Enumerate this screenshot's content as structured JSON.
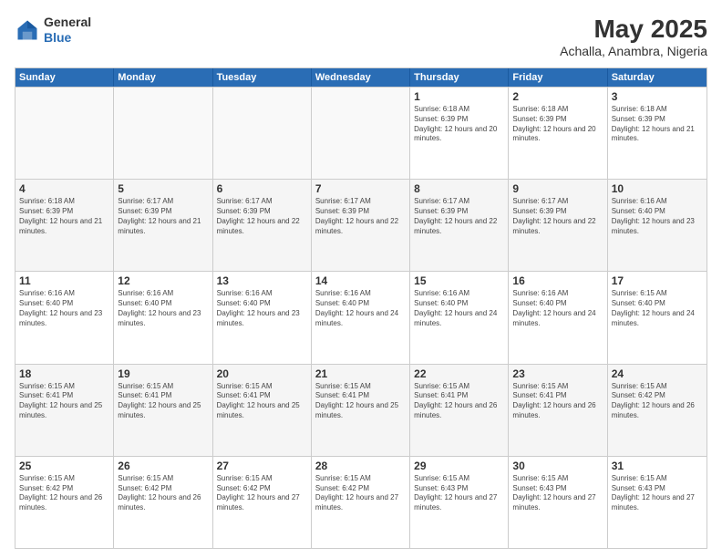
{
  "header": {
    "logo_line1": "General",
    "logo_line2": "Blue",
    "title": "May 2025",
    "subtitle": "Achalla, Anambra, Nigeria"
  },
  "days_of_week": [
    "Sunday",
    "Monday",
    "Tuesday",
    "Wednesday",
    "Thursday",
    "Friday",
    "Saturday"
  ],
  "weeks": [
    [
      {
        "day": "",
        "empty": true
      },
      {
        "day": "",
        "empty": true
      },
      {
        "day": "",
        "empty": true
      },
      {
        "day": "",
        "empty": true
      },
      {
        "day": "1",
        "sunrise": "6:18 AM",
        "sunset": "6:39 PM",
        "daylight": "12 hours and 20 minutes."
      },
      {
        "day": "2",
        "sunrise": "6:18 AM",
        "sunset": "6:39 PM",
        "daylight": "12 hours and 20 minutes."
      },
      {
        "day": "3",
        "sunrise": "6:18 AM",
        "sunset": "6:39 PM",
        "daylight": "12 hours and 21 minutes."
      }
    ],
    [
      {
        "day": "4",
        "sunrise": "6:18 AM",
        "sunset": "6:39 PM",
        "daylight": "12 hours and 21 minutes."
      },
      {
        "day": "5",
        "sunrise": "6:17 AM",
        "sunset": "6:39 PM",
        "daylight": "12 hours and 21 minutes."
      },
      {
        "day": "6",
        "sunrise": "6:17 AM",
        "sunset": "6:39 PM",
        "daylight": "12 hours and 22 minutes."
      },
      {
        "day": "7",
        "sunrise": "6:17 AM",
        "sunset": "6:39 PM",
        "daylight": "12 hours and 22 minutes."
      },
      {
        "day": "8",
        "sunrise": "6:17 AM",
        "sunset": "6:39 PM",
        "daylight": "12 hours and 22 minutes."
      },
      {
        "day": "9",
        "sunrise": "6:17 AM",
        "sunset": "6:39 PM",
        "daylight": "12 hours and 22 minutes."
      },
      {
        "day": "10",
        "sunrise": "6:16 AM",
        "sunset": "6:40 PM",
        "daylight": "12 hours and 23 minutes."
      }
    ],
    [
      {
        "day": "11",
        "sunrise": "6:16 AM",
        "sunset": "6:40 PM",
        "daylight": "12 hours and 23 minutes."
      },
      {
        "day": "12",
        "sunrise": "6:16 AM",
        "sunset": "6:40 PM",
        "daylight": "12 hours and 23 minutes."
      },
      {
        "day": "13",
        "sunrise": "6:16 AM",
        "sunset": "6:40 PM",
        "daylight": "12 hours and 23 minutes."
      },
      {
        "day": "14",
        "sunrise": "6:16 AM",
        "sunset": "6:40 PM",
        "daylight": "12 hours and 24 minutes."
      },
      {
        "day": "15",
        "sunrise": "6:16 AM",
        "sunset": "6:40 PM",
        "daylight": "12 hours and 24 minutes."
      },
      {
        "day": "16",
        "sunrise": "6:16 AM",
        "sunset": "6:40 PM",
        "daylight": "12 hours and 24 minutes."
      },
      {
        "day": "17",
        "sunrise": "6:15 AM",
        "sunset": "6:40 PM",
        "daylight": "12 hours and 24 minutes."
      }
    ],
    [
      {
        "day": "18",
        "sunrise": "6:15 AM",
        "sunset": "6:41 PM",
        "daylight": "12 hours and 25 minutes."
      },
      {
        "day": "19",
        "sunrise": "6:15 AM",
        "sunset": "6:41 PM",
        "daylight": "12 hours and 25 minutes."
      },
      {
        "day": "20",
        "sunrise": "6:15 AM",
        "sunset": "6:41 PM",
        "daylight": "12 hours and 25 minutes."
      },
      {
        "day": "21",
        "sunrise": "6:15 AM",
        "sunset": "6:41 PM",
        "daylight": "12 hours and 25 minutes."
      },
      {
        "day": "22",
        "sunrise": "6:15 AM",
        "sunset": "6:41 PM",
        "daylight": "12 hours and 26 minutes."
      },
      {
        "day": "23",
        "sunrise": "6:15 AM",
        "sunset": "6:41 PM",
        "daylight": "12 hours and 26 minutes."
      },
      {
        "day": "24",
        "sunrise": "6:15 AM",
        "sunset": "6:42 PM",
        "daylight": "12 hours and 26 minutes."
      }
    ],
    [
      {
        "day": "25",
        "sunrise": "6:15 AM",
        "sunset": "6:42 PM",
        "daylight": "12 hours and 26 minutes."
      },
      {
        "day": "26",
        "sunrise": "6:15 AM",
        "sunset": "6:42 PM",
        "daylight": "12 hours and 26 minutes."
      },
      {
        "day": "27",
        "sunrise": "6:15 AM",
        "sunset": "6:42 PM",
        "daylight": "12 hours and 27 minutes."
      },
      {
        "day": "28",
        "sunrise": "6:15 AM",
        "sunset": "6:42 PM",
        "daylight": "12 hours and 27 minutes."
      },
      {
        "day": "29",
        "sunrise": "6:15 AM",
        "sunset": "6:43 PM",
        "daylight": "12 hours and 27 minutes."
      },
      {
        "day": "30",
        "sunrise": "6:15 AM",
        "sunset": "6:43 PM",
        "daylight": "12 hours and 27 minutes."
      },
      {
        "day": "31",
        "sunrise": "6:15 AM",
        "sunset": "6:43 PM",
        "daylight": "12 hours and 27 minutes."
      }
    ]
  ]
}
